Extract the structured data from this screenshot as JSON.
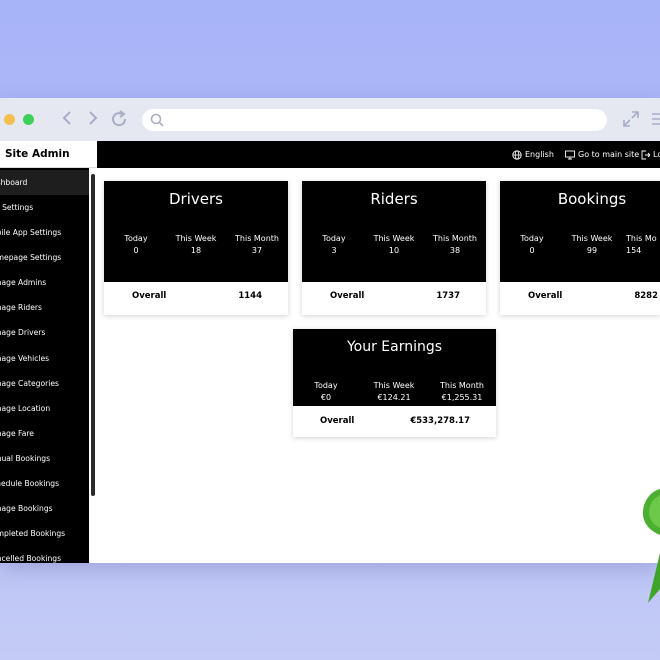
{
  "browser": {
    "url_value": "",
    "url_placeholder": ""
  },
  "header": {
    "brand": "Site Admin",
    "language": "English",
    "main_site": "Go to main site",
    "logout": "Lo"
  },
  "sidebar": {
    "items": [
      {
        "label": "ashboard",
        "active": true
      },
      {
        "label": "te Settings"
      },
      {
        "label": "obile App Settings"
      },
      {
        "label": "omepage Settings"
      },
      {
        "label": "anage Admins"
      },
      {
        "label": "anage Riders"
      },
      {
        "label": "anage Drivers"
      },
      {
        "label": "anage Vehicles"
      },
      {
        "label": "anage Categories"
      },
      {
        "label": "anage Location"
      },
      {
        "label": "anage Fare"
      },
      {
        "label": "anual Bookings"
      },
      {
        "label": "chedule Bookings"
      },
      {
        "label": "anage Bookings"
      },
      {
        "label": "ompleted Bookings"
      },
      {
        "label": "ancelled Bookings"
      }
    ]
  },
  "cards": [
    {
      "title": "Drivers",
      "today_label": "Today",
      "today_value": "0",
      "week_label": "This Week",
      "week_value": "18",
      "month_label": "This Month",
      "month_value": "37",
      "overall_label": "Overall",
      "overall_value": "1144"
    },
    {
      "title": "Riders",
      "today_label": "Today",
      "today_value": "3",
      "week_label": "This Week",
      "week_value": "10",
      "month_label": "This Month",
      "month_value": "38",
      "overall_label": "Overall",
      "overall_value": "1737"
    },
    {
      "title": "Bookings",
      "today_label": "Today",
      "today_value": "0",
      "week_label": "This Week",
      "week_value": "99",
      "month_label": "This Mo",
      "month_value": "154",
      "overall_label": "Overall",
      "overall_value": "8282"
    }
  ],
  "earnings": {
    "title": "Your Earnings",
    "today_label": "Today",
    "today_value": "€0",
    "week_label": "This Week",
    "week_value": "€124.21",
    "month_label": "This Month",
    "month_value": "€1,255.31",
    "overall_label": "Overall",
    "overall_value": "€533,278.17"
  },
  "colors": {
    "background": "#a8b4f8",
    "sidebar": "#000000",
    "card_head": "#000000",
    "badge_green": "#3fa52a"
  },
  "icons": {
    "back": "chevron-left-icon",
    "forward": "chevron-right-icon",
    "reload": "reload-icon",
    "search": "search-icon",
    "expand": "expand-icon",
    "menu": "menu-icon",
    "language": "globe-icon",
    "main_site": "monitor-icon",
    "logout": "logout-icon"
  }
}
